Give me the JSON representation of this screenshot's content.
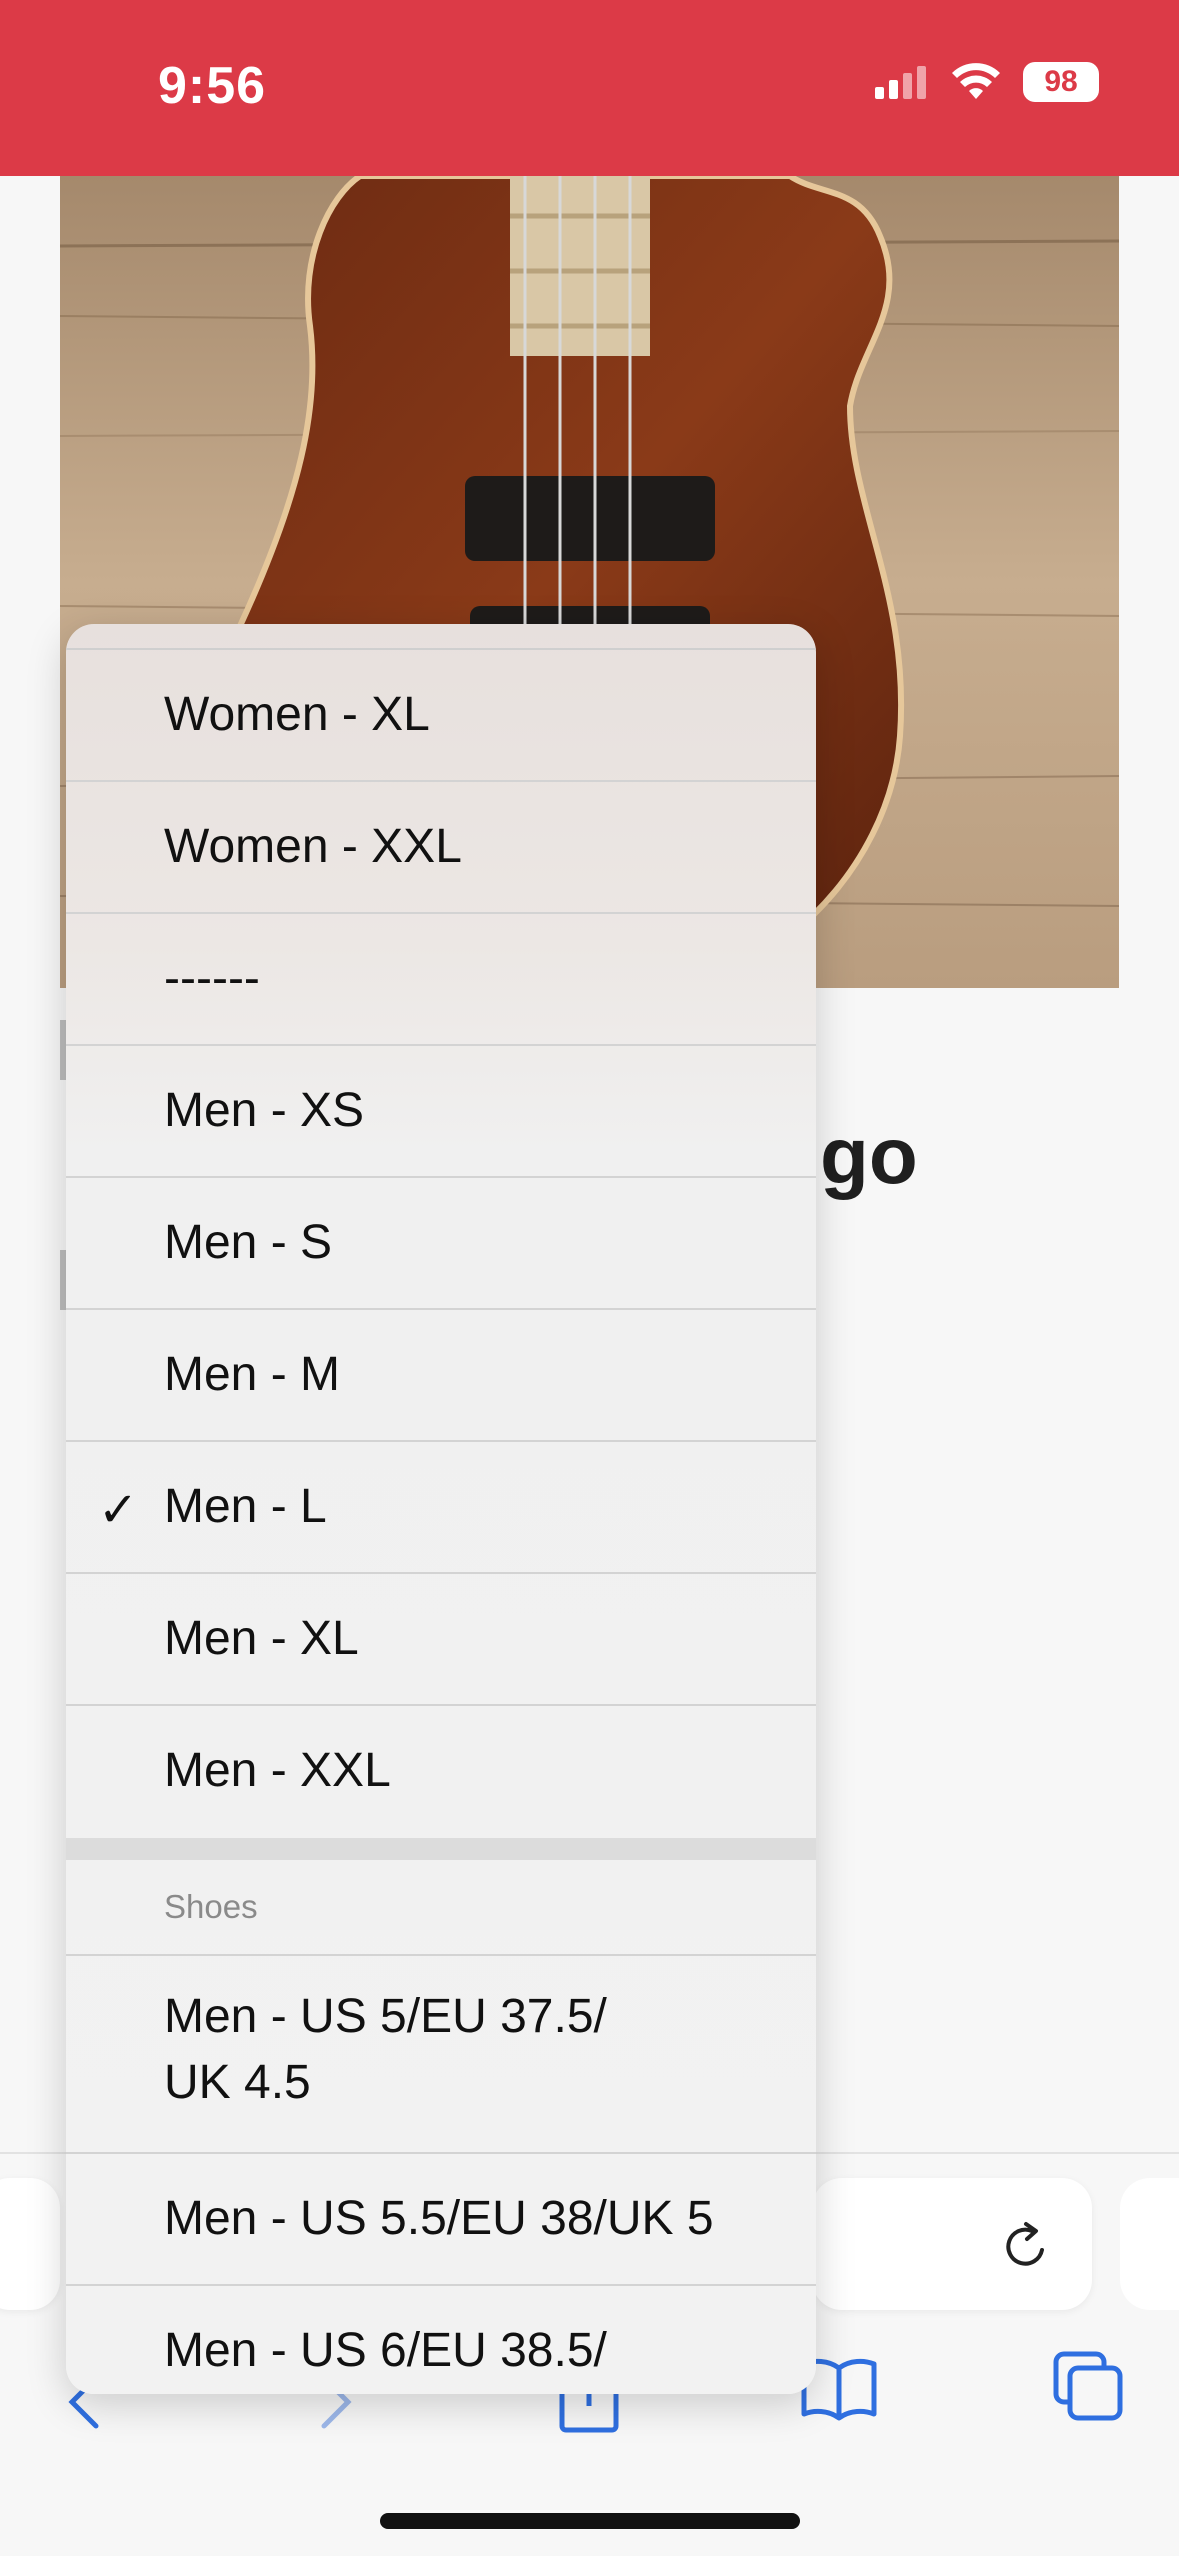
{
  "status_bar": {
    "time": "9:56",
    "battery": "98"
  },
  "page": {
    "title_fragment": "go"
  },
  "menu": {
    "items_group_a": [
      {
        "label": "Women - XL",
        "checked": false
      },
      {
        "label": "Women - XXL",
        "checked": false
      },
      {
        "label": "------",
        "checked": false
      },
      {
        "label": "Men - XS",
        "checked": false
      },
      {
        "label": "Men - S",
        "checked": false
      },
      {
        "label": "Men - M",
        "checked": false
      },
      {
        "label": "Men - L",
        "checked": true
      },
      {
        "label": "Men - XL",
        "checked": false
      },
      {
        "label": "Men - XXL",
        "checked": false
      }
    ],
    "check_glyph": "✓",
    "group_b_header": "Shoes",
    "items_group_b": [
      {
        "label_line1": "Men - US 5/EU 37.5/",
        "label_line2": "UK 4.5"
      },
      {
        "label_line1": "Men - US 5.5/EU 38/UK 5"
      },
      {
        "label_line1": "Men - US 6/EU 38.5/"
      }
    ]
  },
  "toolbar": {
    "icons": [
      "back-icon",
      "forward-icon",
      "share-icon",
      "bookmarks-icon",
      "tabs-icon",
      "reload-icon"
    ],
    "accent_color": "#2f6fe0"
  },
  "colors": {
    "status_bar": "#dc3a47"
  }
}
